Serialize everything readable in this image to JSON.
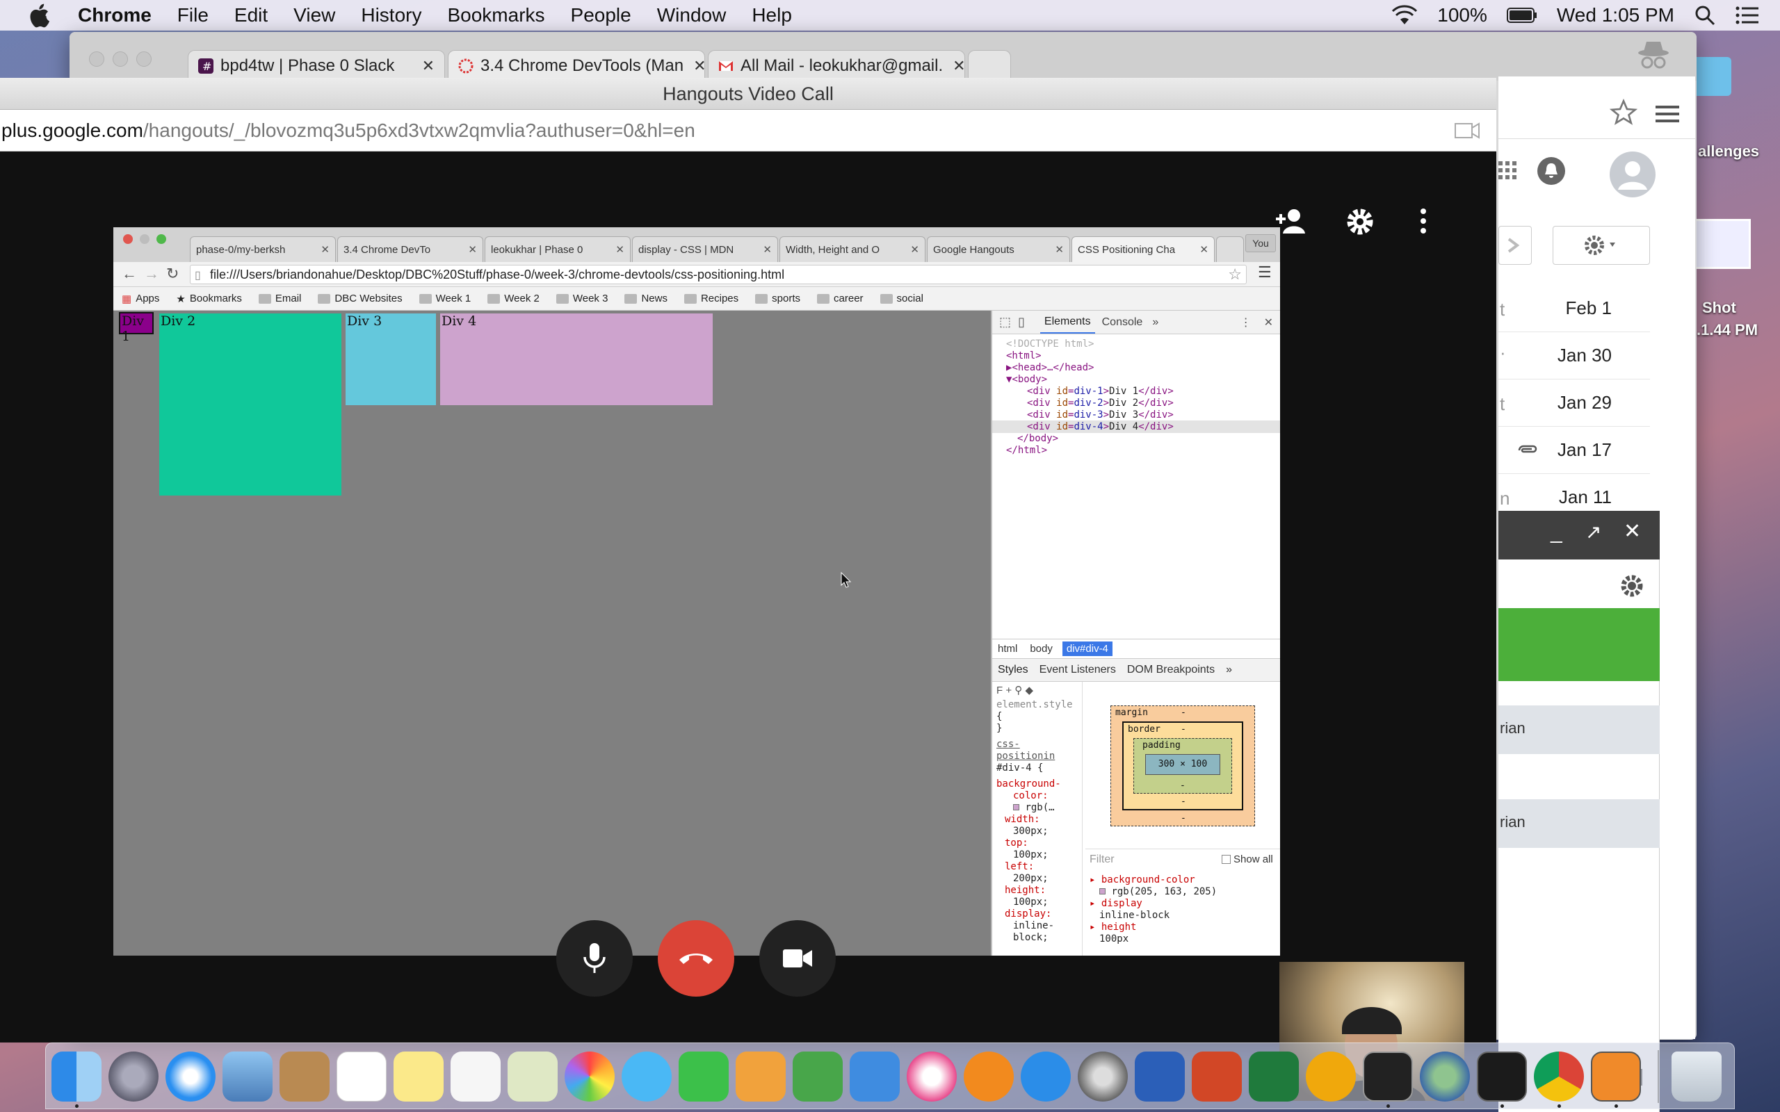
{
  "menubar": {
    "app_name": "Chrome",
    "items": [
      "File",
      "Edit",
      "View",
      "History",
      "Bookmarks",
      "People",
      "Window",
      "Help"
    ],
    "battery": "100%",
    "clock": "Wed 1:05 PM"
  },
  "desktop": {
    "label_challenges": "allenges",
    "label_shot": "Shot",
    "label_shot_time": ".1.44 PM"
  },
  "chrome": {
    "tabs": [
      {
        "label": "bpd4tw | Phase 0 Slack"
      },
      {
        "label": "3.4 Chrome DevTools (Man"
      },
      {
        "label": "All Mail - leokukhar@gmail."
      }
    ]
  },
  "gmail": {
    "dates": [
      "Feb 1",
      "Jan 30",
      "Jan 29",
      "Jan 17",
      "Jan 11"
    ],
    "row_fragments": [
      "t",
      "·",
      "t",
      "",
      "n"
    ],
    "chat_names": [
      "rian",
      "rian"
    ],
    "colors": {
      "green_bar": "#4caf3a",
      "header_dark": "#404040"
    }
  },
  "hangouts": {
    "title": "Hangouts Video Call",
    "url_host": "plus.google.com",
    "url_path": "/hangouts/_/blovozmq3u5p6xd3vtxw2qmvlia?authuser=0&hl=en"
  },
  "shared_screen": {
    "tabs": [
      "phase-0/my-berksh",
      "3.4 Chrome DevTo",
      "leokukhar | Phase 0",
      "display - CSS | MDN",
      "Width, Height and O",
      "Google Hangouts",
      "CSS Positioning Cha"
    ],
    "profile_badge": "You",
    "address": "file:///Users/briandonahue/Desktop/DBC%20Stuff/phase-0/week-3/chrome-devtools/css-positioning.html",
    "bookmarks": [
      "Apps",
      "Bookmarks",
      "Email",
      "DBC Websites",
      "Week 1",
      "Week 2",
      "Week 3",
      "News",
      "Recipes",
      "sports",
      "career",
      "social"
    ],
    "divs": [
      {
        "label": "Div 1",
        "color": "#8b008b"
      },
      {
        "label": "Div 2",
        "color": "#10c89a"
      },
      {
        "label": "Div 3",
        "color": "#64c8dc"
      },
      {
        "label": "Div 4",
        "color": "#cda3cd"
      }
    ]
  },
  "devtools": {
    "tabs": [
      "Elements",
      "Console"
    ],
    "more": "»",
    "dom": {
      "doctype": "<!DOCTYPE html>",
      "html_open": "<html>",
      "head": "<head>…</head>",
      "body_open": "<body>",
      "div1": {
        "id": "div-1",
        "text": "Div 1"
      },
      "div2": {
        "id": "div-2",
        "text": "Div 2"
      },
      "div3": {
        "id": "div-3",
        "text": "Div 3"
      },
      "div4": {
        "id": "div-4",
        "text": "Div 4"
      },
      "body_close": "</body>",
      "html_close": "</html>"
    },
    "breadcrumbs": [
      "html",
      "body",
      "div#div-4"
    ],
    "subtabs": [
      "Styles",
      "Event Listeners",
      "DOM Breakpoints"
    ],
    "styles": {
      "element_style": "element.style",
      "brace_open": "{",
      "brace_close": "}",
      "source": "css-positionin",
      "selector": "#div-4 {",
      "rules": [
        {
          "prop": "background-",
          "prop2": "color:",
          "value": "rgb(…"
        },
        {
          "prop": "width:",
          "value": "300px;"
        },
        {
          "prop": "top:",
          "value": "100px;"
        },
        {
          "prop": "left:",
          "value": "200px;"
        },
        {
          "prop": "height:",
          "value": "100px;"
        },
        {
          "prop": "display:",
          "value": "inline-"
        },
        {
          "prop": "",
          "value": "block;"
        }
      ]
    },
    "box_model": {
      "margin_label": "margin",
      "border_label": "border",
      "padding_label": "padding",
      "dash": "-",
      "content_size": "300 × 100"
    },
    "computed": {
      "filter_placeholder": "Filter",
      "show_all": "Show all",
      "props": [
        {
          "name": "background-color",
          "value": "rgb(205, 163, 205)"
        },
        {
          "name": "display",
          "value": "inline-block"
        },
        {
          "name": "height",
          "value": "100px"
        }
      ]
    }
  }
}
